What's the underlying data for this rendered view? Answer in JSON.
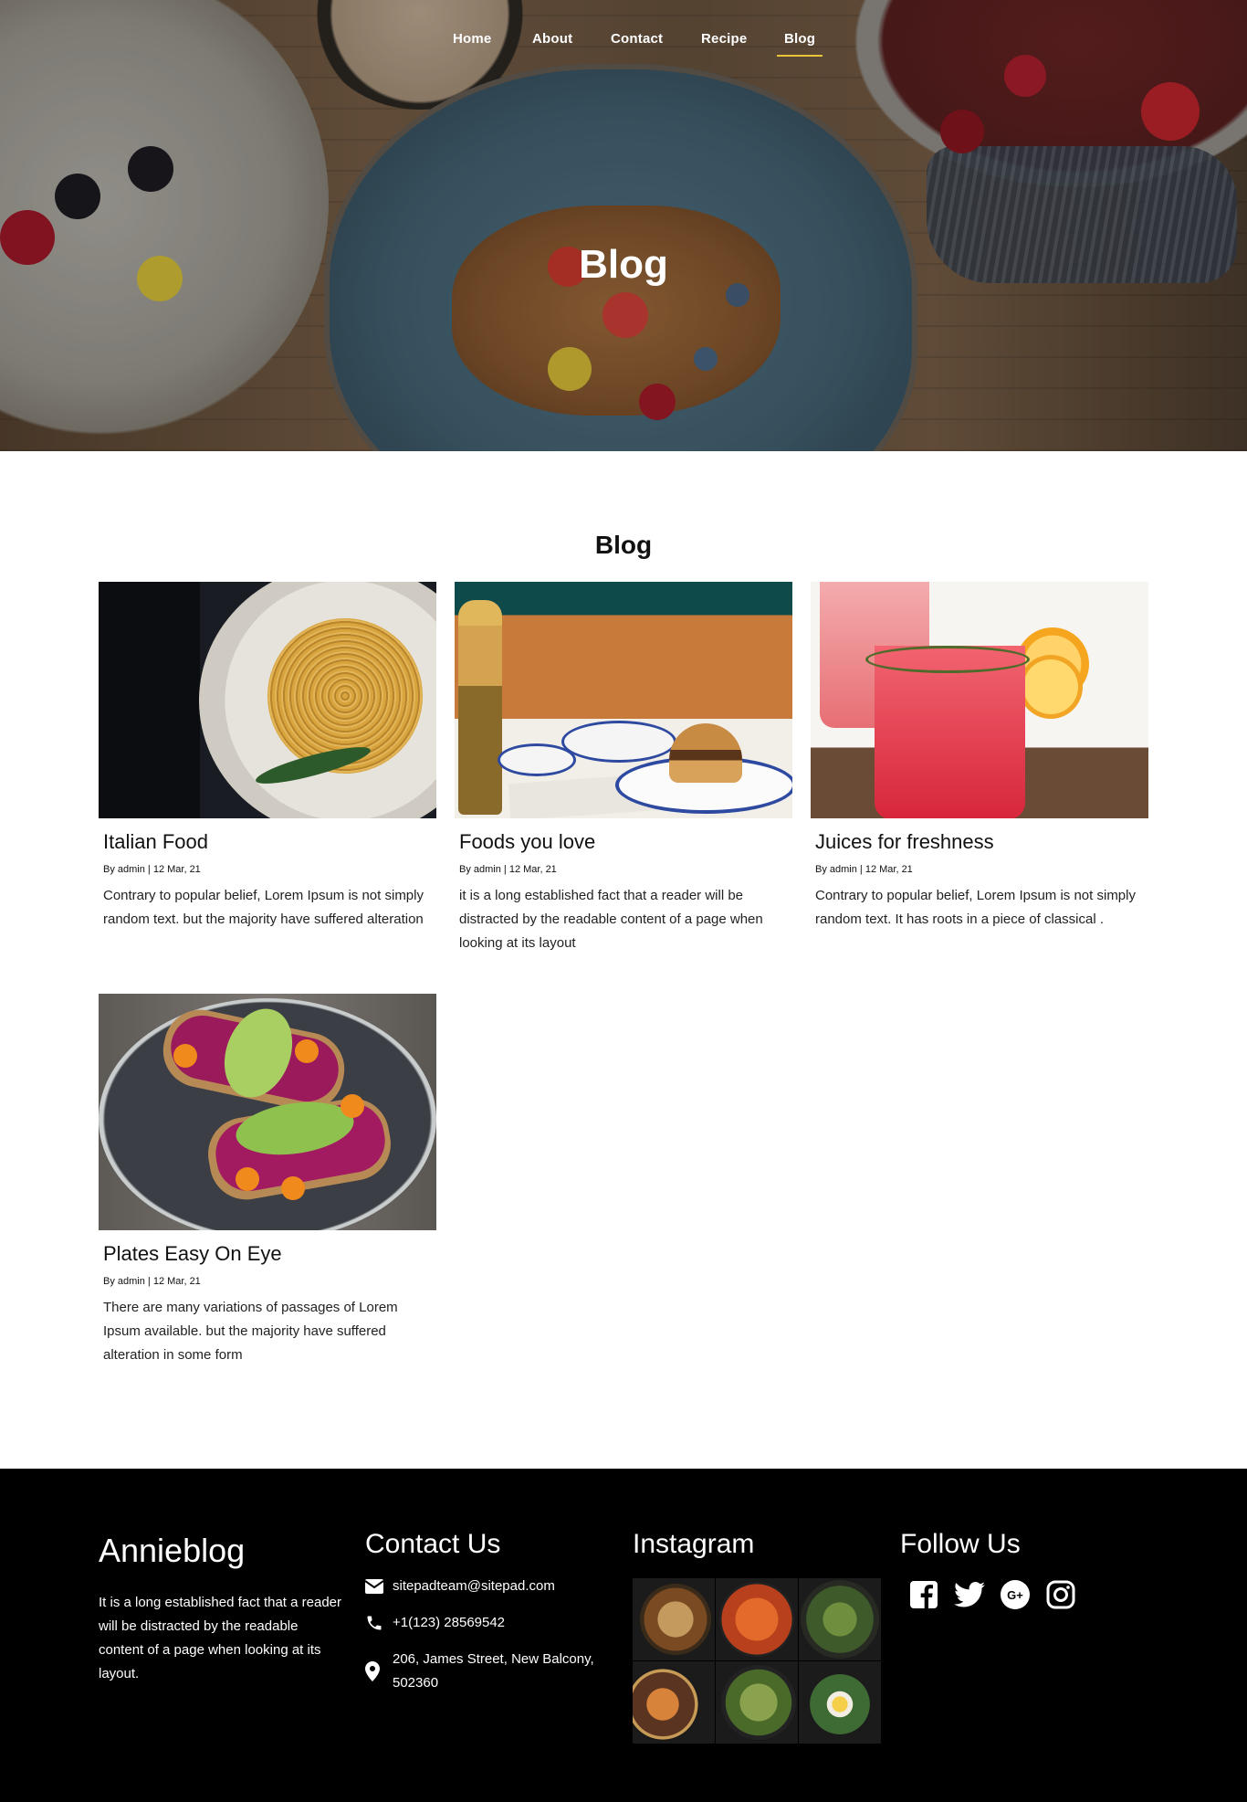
{
  "nav": {
    "items": [
      {
        "label": "Home"
      },
      {
        "label": "About"
      },
      {
        "label": "Contact"
      },
      {
        "label": "Recipe"
      },
      {
        "label": "Blog",
        "active": true
      }
    ]
  },
  "hero": {
    "title": "Blog"
  },
  "blog": {
    "title": "Blog",
    "posts": [
      {
        "title": "Italian Food",
        "meta": "By admin | 12 Mar, 21",
        "excerpt": "Contrary to popular belief, Lorem Ipsum is not simply random text. but the majority have suffered alteration"
      },
      {
        "title": "Foods you love",
        "meta": "By admin | 12 Mar, 21",
        "excerpt": "it is a long established fact that a reader will be distracted by the readable content of a page when looking at its layout"
      },
      {
        "title": "Juices for freshness",
        "meta": "By admin | 12 Mar, 21",
        "excerpt": "Contrary to popular belief, Lorem Ipsum is not simply random text. It has roots in a piece of classical ."
      },
      {
        "title": "Plates Easy On Eye",
        "meta": "By admin | 12 Mar, 21",
        "excerpt": "There are many variations of passages of Lorem Ipsum available. but the majority have suffered alteration in some form"
      }
    ]
  },
  "footer": {
    "brand": "Annieblog",
    "about": "It is a long established fact that a reader will be distracted by the readable content of a page when looking at its layout.",
    "contact": {
      "heading": "Contact Us",
      "email": "sitepadteam@sitepad.com",
      "phone": "+1(123) 28569542",
      "address": "206, James Street, New Balcony, 502360"
    },
    "instagram": {
      "heading": "Instagram"
    },
    "follow": {
      "heading": "Follow Us"
    }
  },
  "colors": {
    "accent": "#e7c53a",
    "footer_bg": "#000000",
    "text": "#111111"
  },
  "icons": [
    "envelope-icon",
    "phone-icon",
    "map-pin-icon",
    "facebook-icon",
    "twitter-icon",
    "google-plus-icon",
    "instagram-icon"
  ]
}
